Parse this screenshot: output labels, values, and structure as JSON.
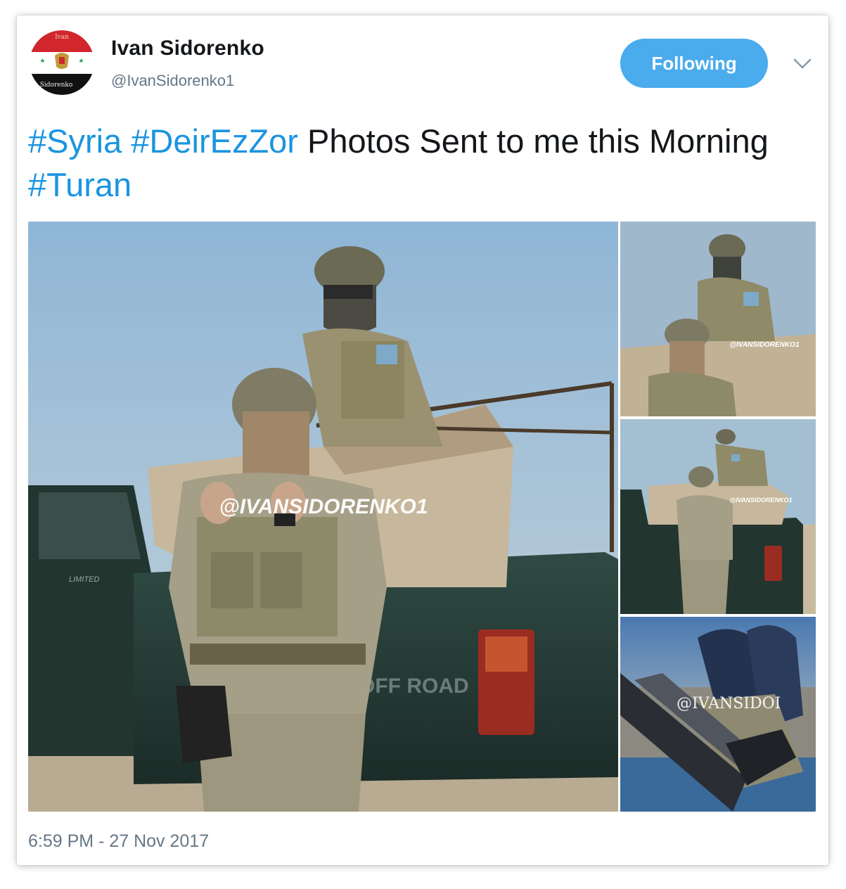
{
  "author": {
    "display_name": "Ivan Sidorenko",
    "handle": "@IvanSidorenko1",
    "avatar_text_top": "Ivan",
    "avatar_text_bottom": "Sidorenko"
  },
  "follow_button": {
    "label": "Following",
    "color": "#4aabed"
  },
  "menu": {
    "icon": "chevron-down-icon"
  },
  "tweet": {
    "segments": [
      {
        "text": "#Syria",
        "type": "hashtag"
      },
      {
        "text": " ",
        "type": "text"
      },
      {
        "text": "#DeirEzZor",
        "type": "hashtag"
      },
      {
        "text": " Photos Sent to me this Morning ",
        "type": "text"
      },
      {
        "text": "#Turan",
        "type": "hashtag"
      }
    ],
    "hashtag_color": "#1b95e0"
  },
  "media": {
    "watermark_main": "@IVANSIDORENKO1",
    "watermark_thumb_1": "@IVANSIDORENKO1",
    "watermark_thumb_2": "@IVANSIDORENKO1",
    "watermark_thumb_3": "@IVANSIDOI",
    "truck_badge": "LIMITED",
    "truck_decal": "OFF ROAD"
  },
  "timestamp": "6:59 PM - 27 Nov 2017"
}
